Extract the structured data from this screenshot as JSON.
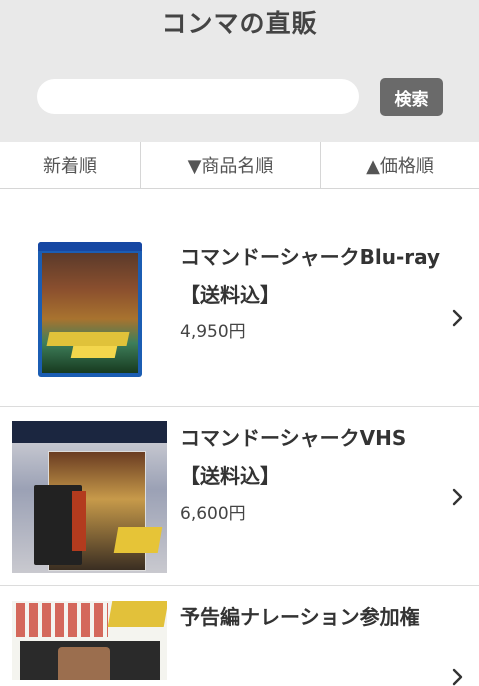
{
  "header": {
    "title": "コンマの直販",
    "search": {
      "placeholder": "",
      "value": "",
      "button_label": "検索"
    }
  },
  "sort_tabs": [
    {
      "label": "新着順"
    },
    {
      "label": "▼商品名順"
    },
    {
      "label": "▲価格順"
    }
  ],
  "products": [
    {
      "name": "コマンドーシャークBlu-ray【送料込】",
      "price": "4,950円"
    },
    {
      "name": "コマンドーシャークVHS【送料込】",
      "price": "6,600円"
    },
    {
      "name": "予告編ナレーション参加権",
      "price": ""
    }
  ],
  "icons": {
    "chevron": "chevron-right-icon",
    "search": "search-button"
  },
  "colors": {
    "header_bg": "#e9e9e9",
    "button_bg": "#6a6a6a",
    "chevron": "#333333"
  }
}
